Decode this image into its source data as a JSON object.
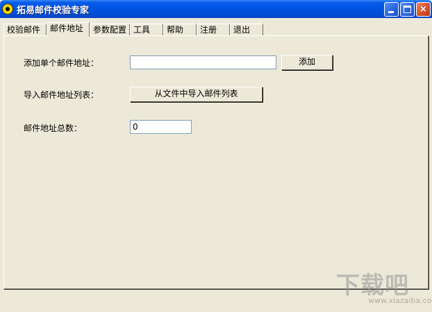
{
  "window": {
    "title": "拓易邮件校验专家",
    "controls": {
      "minimize": "minimize-icon",
      "maximize": "maximize-icon",
      "close": "×"
    }
  },
  "tabs": [
    {
      "label": "校验邮件",
      "active": false
    },
    {
      "label": "邮件地址",
      "active": true
    },
    {
      "label": "参数配置",
      "active": false
    },
    {
      "label": "工具",
      "active": false
    },
    {
      "label": "帮助",
      "active": false
    },
    {
      "label": "注册",
      "active": false
    },
    {
      "label": "退出",
      "active": false
    }
  ],
  "form": {
    "single_address_label": "添加单个邮件地址：",
    "single_address_value": "",
    "add_button": "添加",
    "import_label": "导入邮件地址列表：",
    "import_button": "从文件中导入邮件列表",
    "total_label": "邮件地址总数：",
    "total_value": "0"
  },
  "watermark": {
    "text": "下载吧",
    "sub": "www.xiazaiba.com"
  },
  "colors": {
    "window_bg": "#ECE9D8",
    "titlebar": "#0054E3",
    "close_button": "#D5512B"
  }
}
